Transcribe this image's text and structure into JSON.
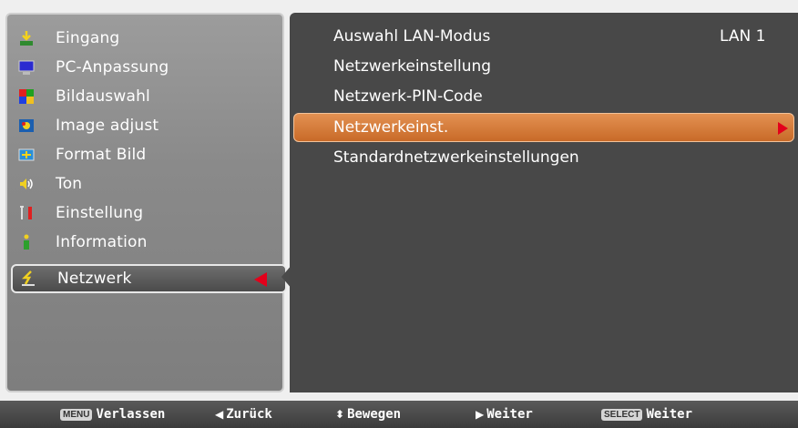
{
  "left_menu": {
    "items": [
      {
        "label": "Eingang",
        "icon": "input-icon"
      },
      {
        "label": "PC‑Anpassung",
        "icon": "monitor-icon"
      },
      {
        "label": "Bildauswahl",
        "icon": "picture-select-icon"
      },
      {
        "label": "Image adjust",
        "icon": "image-adjust-icon"
      },
      {
        "label": "Format Bild",
        "icon": "screen-format-icon"
      },
      {
        "label": "Ton",
        "icon": "speaker-icon"
      },
      {
        "label": "Einstellung",
        "icon": "tools-icon"
      },
      {
        "label": "Information",
        "icon": "info-icon"
      },
      {
        "label": "Netzwerk",
        "icon": "network-icon"
      }
    ],
    "selected_index": 8
  },
  "submenu": {
    "items": [
      {
        "label": "Auswahl LAN‑Modus",
        "value": "LAN 1"
      },
      {
        "label": "Netzwerkeinstellung",
        "value": ""
      },
      {
        "label": "Netzwerk‑PIN‑Code",
        "value": ""
      },
      {
        "label": "Netzwerkeinst.",
        "value": ""
      },
      {
        "label": "Standardnetzwerkeinstellungen",
        "value": ""
      }
    ],
    "active_index": 3
  },
  "footer": {
    "menu_key": "MENU",
    "exit_label": "Verlassen",
    "back_label": "Zurück",
    "move_label": "Bewegen",
    "next_label": "Weiter",
    "select_key": "SELECT",
    "select_label": "Weiter"
  },
  "colors": {
    "highlight": "#d8793a",
    "selection_arrow": "#e3001b"
  }
}
